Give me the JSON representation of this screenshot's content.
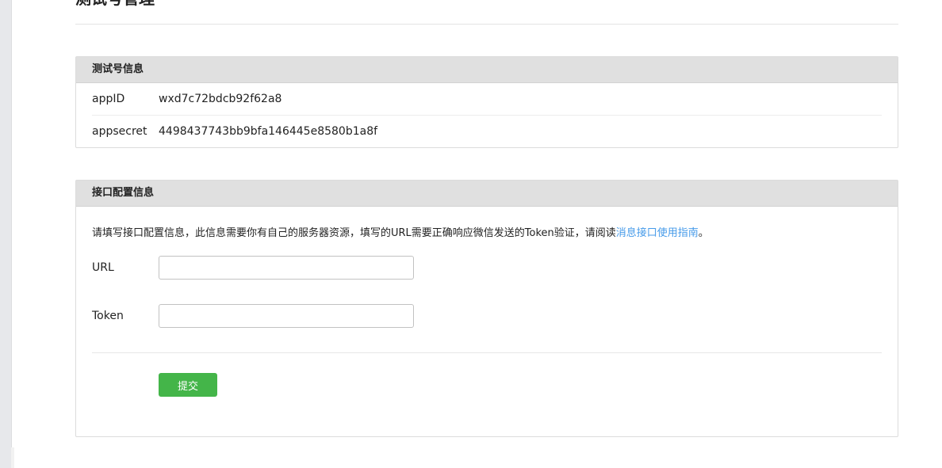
{
  "page": {
    "title": "测试号管理"
  },
  "test_account": {
    "heading": "测试号信息",
    "rows": [
      {
        "label": "appID",
        "value": "wxd7c72bdcb92f62a8"
      },
      {
        "label": "appsecret",
        "value": "4498437743bb9bfa146445e8580b1a8f"
      }
    ]
  },
  "interface_config": {
    "heading": "接口配置信息",
    "intro_text": "请填写接口配置信息，此信息需要你有自己的服务器资源，填写的URL需要正确响应微信发送的Token验证，请阅读",
    "intro_link": "消息接口使用指南",
    "intro_end": "。",
    "url_label": "URL",
    "url_value": "",
    "token_label": "Token",
    "token_value": "",
    "submit_label": "提交"
  },
  "colors": {
    "accent_green": "#44b549",
    "link_blue": "#459ae9",
    "panel_header": "#e0e0e0"
  }
}
